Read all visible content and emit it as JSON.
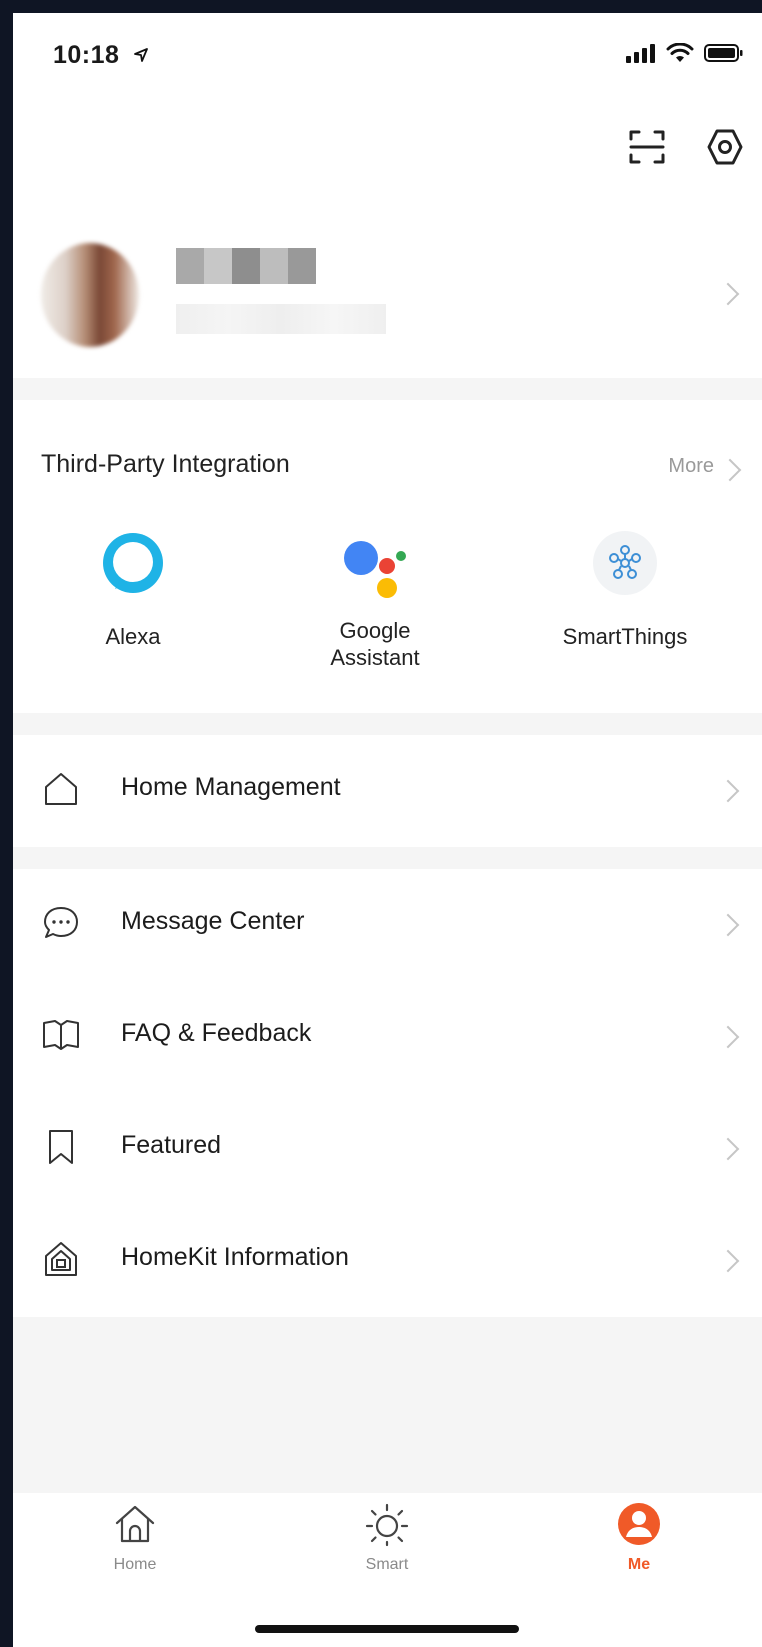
{
  "status_bar": {
    "time": "10:18"
  },
  "profile": {},
  "integrations": {
    "title": "Third-Party Integration",
    "more_label": "More",
    "items": [
      {
        "label": "Alexa"
      },
      {
        "label": "Google\nAssistant"
      },
      {
        "label": "SmartThings"
      }
    ]
  },
  "menu": {
    "home_management": "Home Management",
    "message_center": "Message Center",
    "faq_feedback": "FAQ & Feedback",
    "featured": "Featured",
    "homekit_information": "HomeKit Information"
  },
  "tabs": [
    {
      "label": "Home",
      "active": false
    },
    {
      "label": "Smart",
      "active": false
    },
    {
      "label": "Me",
      "active": true
    }
  ],
  "colors": {
    "accent": "#f05a28",
    "alexa": "#1fb3e6",
    "google_blue": "#4285f4",
    "google_red": "#ea4335",
    "google_yellow": "#fbbc05",
    "google_green": "#34a853",
    "smartthings": "#3d8fd6"
  }
}
